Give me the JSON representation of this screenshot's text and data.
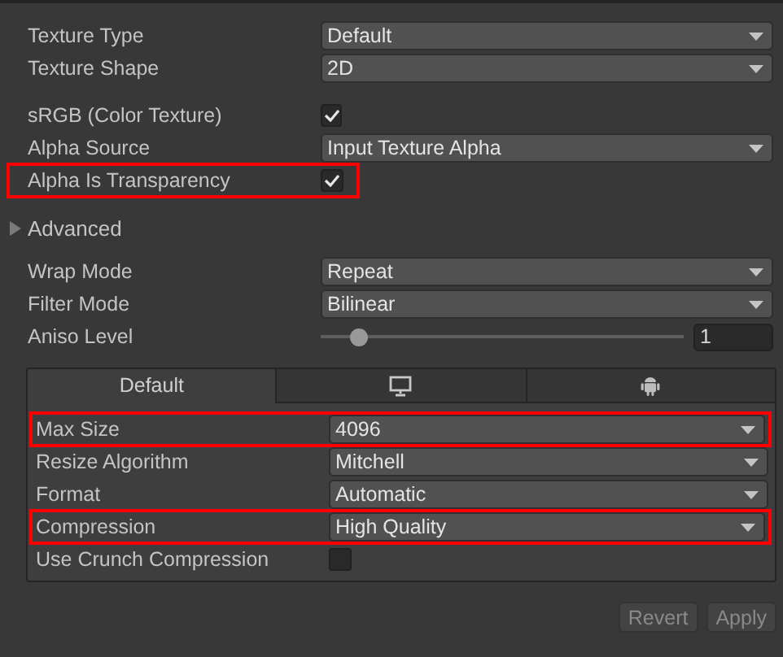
{
  "texture_groups": [
    {
      "rows": [
        {
          "kind": "dropdown",
          "label": "Texture Type",
          "value": "Default",
          "highlighted": false
        },
        {
          "kind": "dropdown",
          "label": "Texture Shape",
          "value": "2D",
          "highlighted": false
        }
      ]
    },
    {
      "rows": [
        {
          "kind": "checkbox",
          "label": "sRGB (Color Texture)",
          "checked": true,
          "highlighted": false
        },
        {
          "kind": "dropdown",
          "label": "Alpha Source",
          "value": "Input Texture Alpha",
          "highlighted": false
        },
        {
          "kind": "checkbox",
          "label": "Alpha Is Transparency",
          "checked": true,
          "highlighted": true
        }
      ]
    }
  ],
  "advanced": {
    "label": "Advanced",
    "expanded": false
  },
  "sampling_rows": [
    {
      "kind": "dropdown",
      "label": "Wrap Mode",
      "value": "Repeat",
      "highlighted": false
    },
    {
      "kind": "dropdown",
      "label": "Filter Mode",
      "value": "Bilinear",
      "highlighted": false
    },
    {
      "kind": "slider",
      "label": "Aniso Level",
      "level": 0.08,
      "value": "1",
      "highlighted": false
    }
  ],
  "platform": {
    "tabs": [
      {
        "kind": "text",
        "label": "Default",
        "selected": true
      },
      {
        "kind": "desktop",
        "selected": false
      },
      {
        "kind": "android",
        "selected": false
      }
    ],
    "rows": [
      {
        "kind": "dropdown",
        "label": "Max Size",
        "value": "4096",
        "highlighted": true
      },
      {
        "kind": "dropdown",
        "label": "Resize Algorithm",
        "value": "Mitchell",
        "highlighted": false
      },
      {
        "kind": "dropdown",
        "label": "Format",
        "value": "Automatic",
        "highlighted": false
      },
      {
        "kind": "dropdown",
        "label": "Compression",
        "value": "High Quality",
        "highlighted": true
      },
      {
        "kind": "checkbox",
        "label": "Use Crunch Compression",
        "checked": false,
        "highlighted": false
      }
    ]
  },
  "buttons": [
    {
      "label": "Revert",
      "disabled": true
    },
    {
      "label": "Apply",
      "disabled": true
    }
  ]
}
